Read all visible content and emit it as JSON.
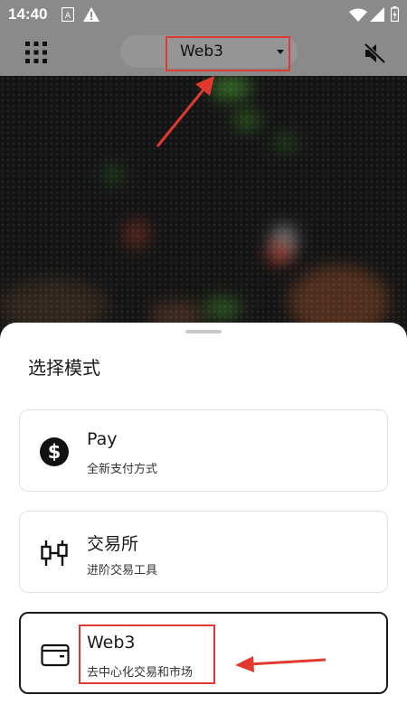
{
  "status_bar": {
    "time": "14:40",
    "icons": [
      "keyboard-icon",
      "warning-icon",
      "wifi-icon",
      "signal-icon",
      "battery-icon"
    ]
  },
  "top_bar": {
    "mode_selector_label": "Web3",
    "icons": [
      "grid-menu-icon",
      "volume-mute-icon"
    ]
  },
  "sheet": {
    "title": "选择模式",
    "options": [
      {
        "title": "Pay",
        "subtitle": "全新支付方式",
        "icon": "dollar-coin-icon",
        "selected": false
      },
      {
        "title": "交易所",
        "subtitle": "进阶交易工具",
        "icon": "candlestick-icon",
        "selected": false
      },
      {
        "title": "Web3",
        "subtitle": "去中心化交易和市场",
        "icon": "wallet-icon",
        "selected": true
      }
    ]
  },
  "colors": {
    "scrim": "#8a8a8a",
    "annotation_red": "#e0392f",
    "sheet_bg": "#ffffff",
    "text": "#1b1b1b"
  }
}
